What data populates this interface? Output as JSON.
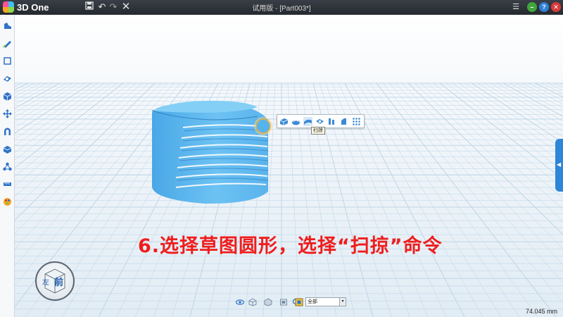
{
  "app": {
    "name": "3D One",
    "window_title": "试用版 - [Part003*]"
  },
  "titlebar": {
    "icons": [
      "save-icon",
      "undo-icon",
      "redo-icon",
      "close-doc-icon"
    ],
    "window_buttons": [
      "app-menu-icon",
      "minimize-icon",
      "help-icon",
      "close-icon"
    ]
  },
  "left_toolbar": {
    "icons": [
      "boot-icon",
      "sketch-pen-icon",
      "sketch-edit-icon",
      "special-feature-icon",
      "basic-solid-icon",
      "move-icon",
      "magnet-icon",
      "combine-icon",
      "distribute-icon",
      "measure-icon",
      "material-icon"
    ]
  },
  "context_toolbar": {
    "icons": [
      "extrude-icon",
      "revolve-icon",
      "sweep-icon",
      "loft-icon",
      "pipe-icon",
      "chamfer-icon",
      "more-grid-icon"
    ],
    "tooltip": "扫掠"
  },
  "instruction": "6.选择草图圆形，选择“扫掠”命令",
  "view_cube": {
    "front_label": "前",
    "left_label": "左"
  },
  "bottom_bar": {
    "icons": [
      "view-eye-icon",
      "view-wire-icon",
      "view-shaded-icon",
      "view-render-icon",
      "zoom-search-icon",
      "pick-filter-icon"
    ],
    "filter_value": "全部"
  },
  "status": {
    "scale": "74.045 mm"
  },
  "colors": {
    "model": "#5fb8ee",
    "model_dark": "#3a95d4",
    "instruction": "#ef1d1d",
    "grid": "#b9d3e6",
    "accent": "#2e86d8"
  }
}
